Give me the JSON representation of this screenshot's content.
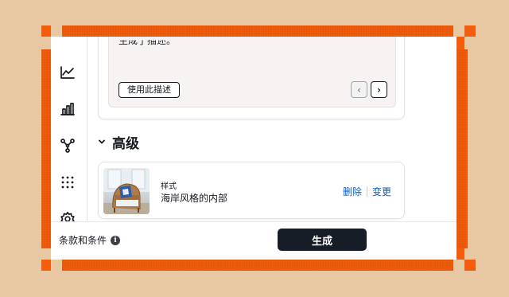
{
  "rail": {
    "icons": [
      "line-chart-icon",
      "bar-chart-icon",
      "network-icon",
      "grid-dots-icon",
      "gear-icon"
    ]
  },
  "description": {
    "text": "生成了描述。",
    "use_button": "使用此描述",
    "prev": "‹",
    "next": "›"
  },
  "advanced": {
    "chevron": "›",
    "title": "高级"
  },
  "style": {
    "label": "样式",
    "value": "海岸风格的内部",
    "delete": "删除",
    "change": "变更"
  },
  "footer": {
    "terms": "条款和条件",
    "info": "i",
    "generate": "生成"
  },
  "colors": {
    "frame": "#f25e0e",
    "background": "#e8c8a2",
    "link": "#0b5fbf",
    "primary_button": "#161d26"
  }
}
